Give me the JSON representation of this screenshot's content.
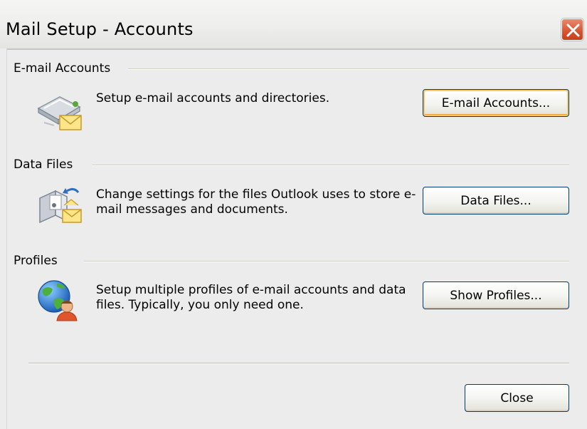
{
  "window": {
    "title": "Mail Setup - Accounts"
  },
  "sections": [
    {
      "title": "E-mail Accounts",
      "icon": "email-accounts-icon",
      "description": "Setup e-mail accounts and directories.",
      "button_label": "E-mail Accounts..."
    },
    {
      "title": "Data Files",
      "icon": "data-files-icon",
      "description": "Change settings for the files Outlook uses to store e-mail messages and documents.",
      "button_label": "Data Files..."
    },
    {
      "title": "Profiles",
      "icon": "profiles-icon",
      "description": "Setup multiple profiles of e-mail accounts and data files. Typically, you only need one.",
      "button_label": "Show Profiles..."
    }
  ],
  "footer": {
    "close_label": "Close"
  },
  "colors": {
    "close_button": "#d55430",
    "button_border": "#003c74",
    "focus_highlight": "#f9c866"
  }
}
